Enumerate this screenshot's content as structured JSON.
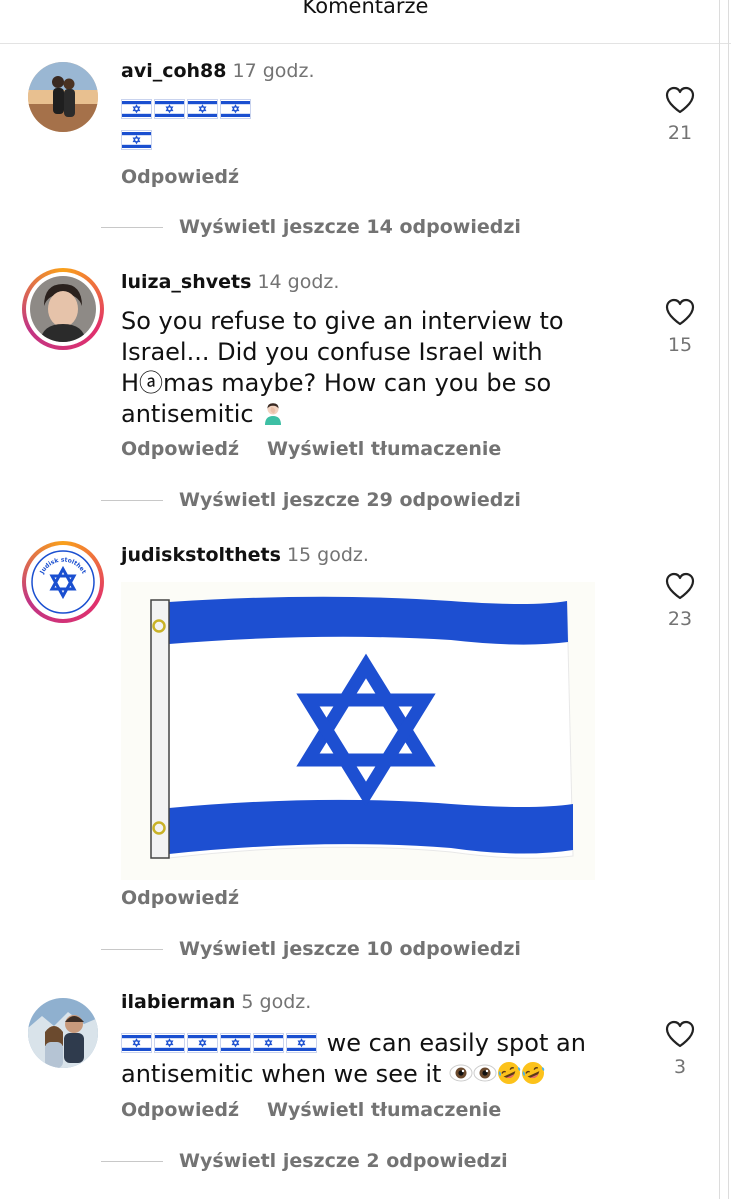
{
  "header": {
    "title": "Komentarze"
  },
  "comments": [
    {
      "username": "avi_coh88",
      "time": "17 godz.",
      "likes": "21",
      "reply_label": "Odpowiedź",
      "replies_label": "Wyświetl jeszcze 14 odpowiedzi",
      "content": [
        "flag",
        "flag",
        "flag",
        "flag",
        "flag"
      ]
    },
    {
      "username": "luiza_shvets",
      "time": "14 godz.",
      "likes": "15",
      "text": "So you refuse to give an interview to Israel... Did you confuse Israel with Hⓐmas maybe? How can you be so antisemitic",
      "reply_label": "Odpowiedź",
      "translate_label": "Wyświetl tłumaczenie",
      "replies_label": "Wyświetl jeszcze 29 odpowiedzi"
    },
    {
      "username": "judiskstolthets",
      "time": "15 godz.",
      "likes": "23",
      "reply_label": "Odpowiedź",
      "replies_label": "Wyświetl jeszcze 10 odpowiedzi",
      "avatar_text": "Judisk stolthet"
    },
    {
      "username": "ilabierman",
      "time": "5 godz.",
      "likes": "3",
      "text_a": "we can easily spot an",
      "text_b": "antisemitic when we see it",
      "reply_label": "Odpowiedź",
      "translate_label": "Wyświetl tłumaczenie",
      "replies_label": "Wyświetl jeszcze 2 odpowiedzi"
    }
  ],
  "colors": {
    "israel_blue": "#1a4fd0",
    "muted": "#737373"
  }
}
